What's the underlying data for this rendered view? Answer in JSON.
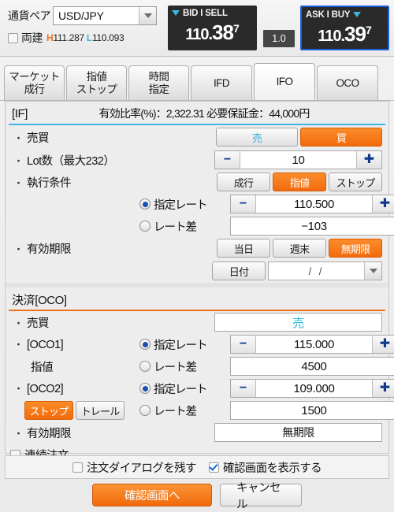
{
  "quote": {
    "pair_label": "通貨ペア",
    "pair_value": "USD/JPY",
    "hedge_label": "両建",
    "high_prefix": "H",
    "high_value": "111.287",
    "low_prefix": "L",
    "low_value": "110.093",
    "bid_title": "BID I SELL",
    "bid_big": "110.",
    "bid_mid": "38",
    "bid_sup": "7",
    "ask_title": "ASK I BUY",
    "ask_big": "110.",
    "ask_mid": "39",
    "ask_sup": "7",
    "spread": "1.0",
    "accent_blue": "#1a5fe0",
    "accent_cyan": "#3bb7dd",
    "accent_orange": "#f27024"
  },
  "tabs": [
    {
      "line1": "マーケット",
      "line2": "成行",
      "active": false
    },
    {
      "line1": "指値",
      "line2": "ストップ",
      "active": false
    },
    {
      "line1": "時間",
      "line2": "指定",
      "active": false
    },
    {
      "line1": "IFD",
      "line2": "",
      "active": false
    },
    {
      "line1": "IFO",
      "line2": "",
      "active": true
    },
    {
      "line1": "OCO",
      "line2": "",
      "active": false
    }
  ],
  "if_section": {
    "title": "[IF]",
    "meta": "有効比率(%)：2,322.31 必要保証金：44,000円",
    "side_label": "売買",
    "side_sell": "売",
    "side_buy": "買",
    "side_selected": "買",
    "lot_label": "Lot数（最大232）",
    "lot_minus": "−",
    "lot_value": "10",
    "lot_plus": "✚",
    "exec_label": "執行条件",
    "exec_market": "成行",
    "exec_limit": "指値",
    "exec_stop": "ストップ",
    "exec_selected": "指値",
    "rate_radio_label": "指定レート",
    "rate_minus": "−",
    "rate_value": "110.500",
    "rate_plus": "✚",
    "diff_radio_label": "レート差",
    "diff_value": "−103",
    "expiry_label": "有効期限",
    "expiry_today": "当日",
    "expiry_weekend": "週末",
    "expiry_none": "無期限",
    "expiry_selected": "無期限",
    "expiry_date_btn": "日付",
    "expiry_date_value": "/    /"
  },
  "oco_section": {
    "title": "決済[OCO]",
    "side_label": "売買",
    "side_value": "売",
    "oco1_label": "[OCO1]",
    "oco1_sub": "指値",
    "oco1_rate_radio": "指定レート",
    "oco1_minus": "−",
    "oco1_rate_value": "115.000",
    "oco1_plus": "✚",
    "oco1_diff_radio": "レート差",
    "oco1_diff_value": "4500",
    "oco2_label": "[OCO2]",
    "oco2_stop_btn": "ストップ",
    "oco2_trail_btn": "トレール",
    "oco2_selected": "ストップ",
    "oco2_rate_radio": "指定レート",
    "oco2_minus": "−",
    "oco2_rate_value": "109.000",
    "oco2_plus": "✚",
    "oco2_diff_radio": "レート差",
    "oco2_diff_value": "1500",
    "expiry_label": "有効期限",
    "expiry_value": "無期限",
    "repeat_label": "連続注文"
  },
  "footer": {
    "keep_dialog_label": "注文ダイアログを残す",
    "keep_dialog_checked": false,
    "confirm_screen_label": "確認画面を表示する",
    "confirm_screen_checked": true,
    "submit_label": "確認画面へ",
    "cancel_label": "キャンセル"
  }
}
